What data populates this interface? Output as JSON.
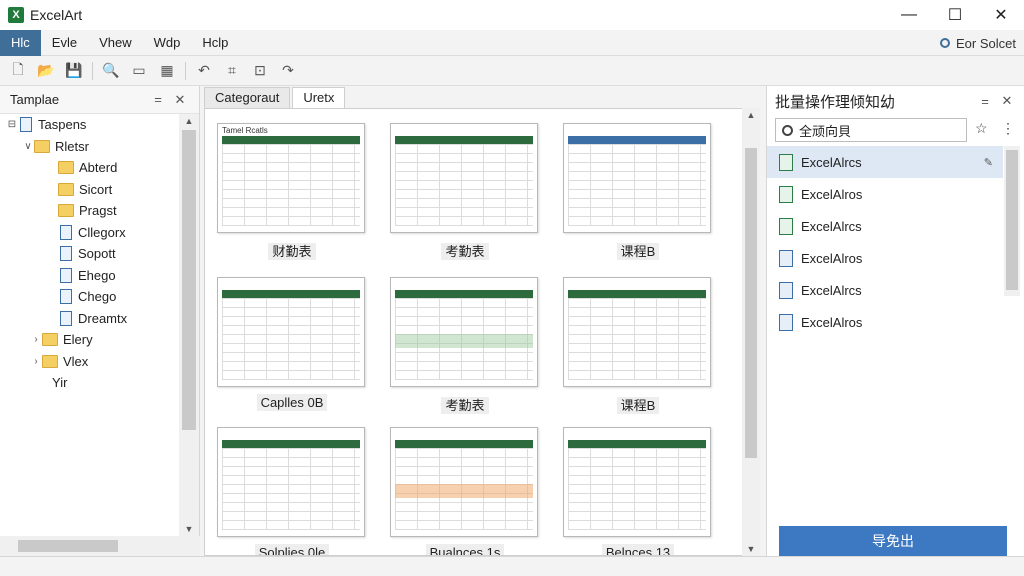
{
  "window": {
    "title": "ExcelArt",
    "minimize": "—",
    "maximize": "☐",
    "close": "✕"
  },
  "menu": {
    "items": [
      "Hlc",
      "Evle",
      "Vhew",
      "Wdp",
      "Hclp"
    ],
    "active_index": 0,
    "account_label": "Eor Solcet"
  },
  "toolbar": {
    "icons": [
      "new-icon",
      "open-icon",
      "save-icon",
      "zoom-icon",
      "view-icon",
      "image-icon",
      "undo-icon",
      "crop-icon",
      "frame-icon",
      "redo-icon"
    ]
  },
  "left_panel": {
    "title": "Tamplae",
    "pin": "=",
    "close": "✕",
    "tree": [
      {
        "label": "Taspens",
        "arrow": "⊟",
        "icon": "doc"
      },
      {
        "label": "Rletsr",
        "arrow": "∨",
        "icon": "folder"
      },
      {
        "label": "Abterd",
        "arrow": "",
        "icon": "folder"
      },
      {
        "label": "Sicort",
        "arrow": "",
        "icon": "folder"
      },
      {
        "label": "Pragst",
        "arrow": "",
        "icon": "folder"
      },
      {
        "label": "Cllegorx",
        "arrow": "",
        "icon": "doc"
      },
      {
        "label": "Sopott",
        "arrow": "",
        "icon": "doc"
      },
      {
        "label": "Ehego",
        "arrow": "",
        "icon": "doc"
      },
      {
        "label": "Chego",
        "arrow": "",
        "icon": "doc"
      },
      {
        "label": "Dreamtx",
        "arrow": "",
        "icon": "doc"
      },
      {
        "label": "Elery",
        "arrow": "›",
        "icon": "folder"
      },
      {
        "label": "Vlex",
        "arrow": "›",
        "icon": "folder"
      },
      {
        "label": "Yir",
        "arrow": "",
        "icon": "none"
      }
    ]
  },
  "center": {
    "tabs": [
      "Categoraut",
      "Uretx"
    ],
    "active_tab": 1,
    "cards": [
      {
        "label": "财勤表",
        "thumb_title": "Tamel Rcatls",
        "accent": "#2d6a3e"
      },
      {
        "label": "考勤表",
        "thumb_title": "",
        "accent": "#2d6a3e"
      },
      {
        "label": "课程B",
        "thumb_title": "",
        "accent": "#3b6fa6"
      },
      {
        "label": "Caplles 0B",
        "thumb_title": "",
        "accent": "#2d6a3e"
      },
      {
        "label": "考勤表",
        "thumb_title": "",
        "accent": "#2d6a3e"
      },
      {
        "label": "课程B",
        "thumb_title": "",
        "accent": "#2d6a3e"
      },
      {
        "label": "Solplies 0le",
        "thumb_title": "",
        "accent": "#2d6a3e"
      },
      {
        "label": "Bualnces 1s",
        "thumb_title": "",
        "accent": "#2d6a3e"
      },
      {
        "label": "Belnces 13",
        "thumb_title": "",
        "accent": "#2d6a3e"
      }
    ]
  },
  "right_panel": {
    "title": "批量操作理倾知幼",
    "pin": "=",
    "close": "✕",
    "search_value": "全顽向貝",
    "fav": "☆",
    "more": "⋮",
    "files": [
      {
        "label": "ExcelAlrcs",
        "color": "green",
        "selected": true,
        "pin": "✎"
      },
      {
        "label": "ExcelAlros",
        "color": "green",
        "selected": false,
        "pin": ""
      },
      {
        "label": "ExcelAlrcs",
        "color": "green",
        "selected": false,
        "pin": ""
      },
      {
        "label": "ExcelAlros",
        "color": "blue",
        "selected": false,
        "pin": ""
      },
      {
        "label": "ExcelAlrcs",
        "color": "blue",
        "selected": false,
        "pin": ""
      },
      {
        "label": "ExcelAlros",
        "color": "blue",
        "selected": false,
        "pin": ""
      }
    ],
    "action_label": "导免出"
  }
}
